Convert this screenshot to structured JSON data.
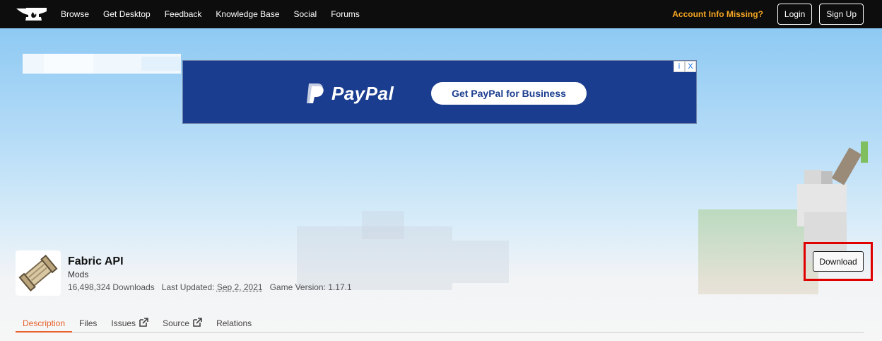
{
  "nav": {
    "items": [
      "Browse",
      "Get Desktop",
      "Feedback",
      "Knowledge Base",
      "Social",
      "Forums"
    ],
    "account_missing": "Account Info Missing?",
    "login": "Login",
    "signup": "Sign Up"
  },
  "ad": {
    "brand": "PayPal",
    "cta": "Get PayPal for Business",
    "info_glyph": "i",
    "close_glyph": "X"
  },
  "project": {
    "title": "Fabric API",
    "category": "Mods",
    "downloads": "16,498,324 Downloads",
    "last_updated_label": "Last Updated:",
    "last_updated_value": "Sep 2, 2021",
    "game_version": "Game Version: 1.17.1",
    "download_button": "Download"
  },
  "tabs": [
    {
      "label": "Description",
      "active": true,
      "external": false
    },
    {
      "label": "Files",
      "active": false,
      "external": false
    },
    {
      "label": "Issues",
      "active": false,
      "external": true
    },
    {
      "label": "Source",
      "active": false,
      "external": true
    },
    {
      "label": "Relations",
      "active": false,
      "external": false
    }
  ],
  "colors": {
    "accent": "#e8612c",
    "warning": "#f5a623",
    "highlight": "#e00000",
    "ad_bg": "#1b3d8f"
  },
  "icons": {
    "logo": "anvil-logo-icon",
    "project": "scroll-icon",
    "external": "external-link-icon"
  }
}
